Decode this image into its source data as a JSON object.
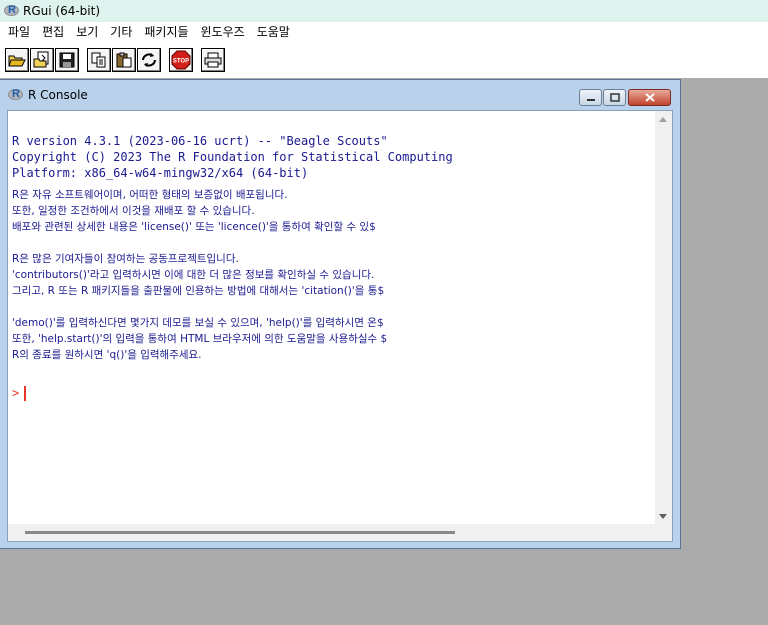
{
  "app": {
    "title": "RGui (64-bit)"
  },
  "menu": [
    "파일",
    "편집",
    "보기",
    "기타",
    "패키지들",
    "윈도우즈",
    "도움말"
  ],
  "toolbar": {
    "buttons": [
      "open-script-icon",
      "load-workspace-icon",
      "save-workspace-icon",
      "copy-icon",
      "paste-icon",
      "copy-paste-icon",
      "stop-icon",
      "print-icon"
    ],
    "stop_label": "STOP"
  },
  "console": {
    "title": "R Console",
    "lines": [
      "R version 4.3.1 (2023-06-16 ucrt) -- \"Beagle Scouts\"",
      "Copyright (C) 2023 The R Foundation for Statistical Computing",
      "Platform: x86_64-w64-mingw32/x64 (64-bit)",
      "",
      "R은 자유 소프트웨어이며, 어떠한 형태의 보증없이 배포됩니다.",
      "또한, 일정한 조건하에서 이것을 재배포 할 수 있습니다.",
      "배포와 관련된 상세한 내용은 'license()' 또는 'licence()'을 통하여 확인할 수 있$",
      "",
      "R은 많은 기여자들이 참여하는 공동프로젝트입니다.",
      "'contributors()'라고 입력하시면 이에 대한 더 많은 정보를 확인하실 수 있습니다.",
      "그리고, R 또는 R 패키지들을 출판물에 인용하는 방법에 대해서는 'citation()'을 통$",
      "",
      "'demo()'를 입력하신다면 몇가지 데모를 보실 수 있으며, 'help()'를 입력하시면 온$",
      "또한, 'help.start()'의 입력을 통하여 HTML 브라우저에 의한 도움말을 사용하실수 $",
      "R의 종료를 원하시면 'q()'을 입력해주세요."
    ],
    "prompt": ">"
  },
  "colors": {
    "console_text": "#1a1a8f",
    "prompt": "#e8372a",
    "titlebar": "#dff3ee",
    "workspace": "#ababab"
  }
}
